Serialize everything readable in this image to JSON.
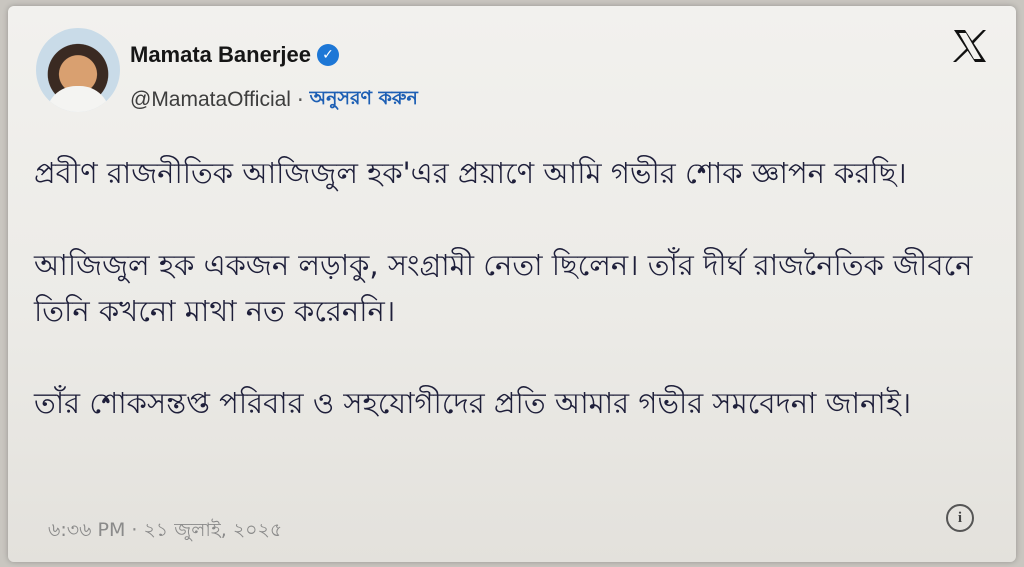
{
  "author": {
    "name": "Mamata Banerjee",
    "handle": "@MamataOfficial",
    "separator": "·",
    "follow_label": "অনুসরণ করুন"
  },
  "icons": {
    "brand": "x-logo-icon",
    "verified": "verified-badge-icon",
    "info": "info-icon",
    "verified_color": "#1d77d6"
  },
  "tweet": {
    "paragraphs": [
      "প্রবীণ রাজনীতিক আজিজুল হক'এর প্রয়াণে আমি গভীর শোক জ্ঞাপন করছি।",
      "আজিজুল হক একজন লড়াকু, সংগ্রামী নেতা ছিলেন। তাঁর দীর্ঘ রাজনৈতিক জীবনে তিনি কখনো মাথা নত করেননি।",
      "তাঁর শোকসন্তপ্ত পরিবার ও সহযোগীদের প্রতি আমার গভীর সমবেদনা জানাই।"
    ],
    "timestamp": "৬:৩৬ PM · ২১ জুলাই, ২০২৫"
  }
}
